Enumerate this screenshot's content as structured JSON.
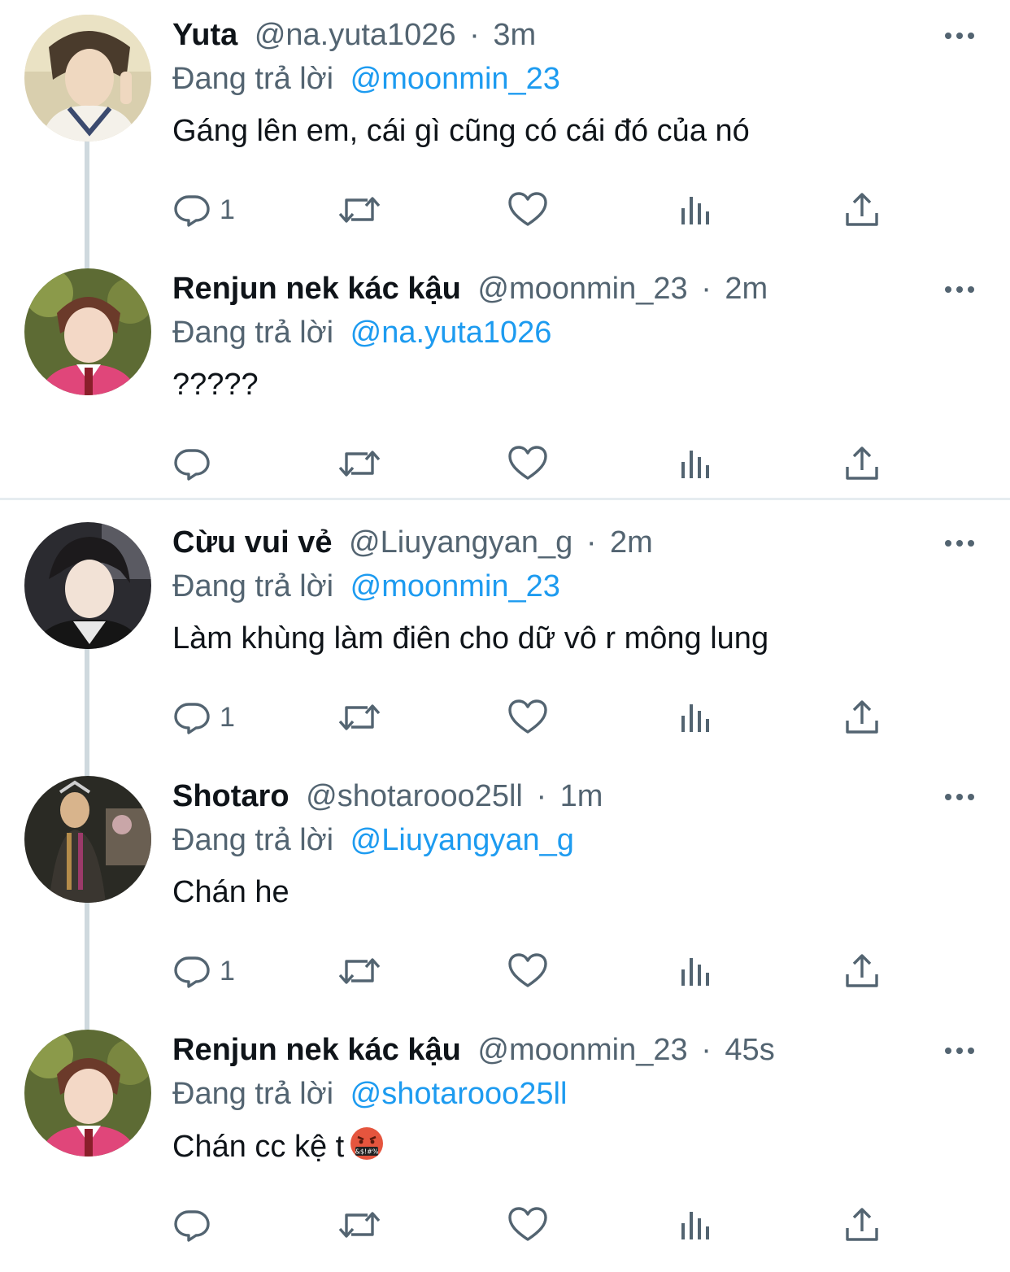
{
  "tweets": [
    {
      "name": "Yuta",
      "handle": "@na.yuta1026",
      "dot": "·",
      "time": "3m",
      "reply_prefix": "Đang trả lời",
      "reply_to": "@moonmin_23",
      "text": "Gáng lên em, cái gì cũng có cái đó của nó",
      "reply_count": "1",
      "avatar": "avatar-yuta"
    },
    {
      "name": "Renjun nek kác kậu",
      "handle": "@moonmin_23",
      "dot": "·",
      "time": "2m",
      "reply_prefix": "Đang trả lời",
      "reply_to": "@na.yuta1026",
      "text": "?????",
      "reply_count": "",
      "avatar": "avatar-renjun"
    },
    {
      "name": "Cừu vui vẻ",
      "handle": "@Liuyangyan_g",
      "dot": "·",
      "time": "2m",
      "reply_prefix": "Đang trả lời",
      "reply_to": "@moonmin_23",
      "text": "Làm khùng làm điên cho dữ vô r mông lung",
      "reply_count": "1",
      "avatar": "avatar-cuu"
    },
    {
      "name": "Shotaro",
      "handle": "@shotarooo25ll",
      "dot": "·",
      "time": "1m",
      "reply_prefix": "Đang trả lời",
      "reply_to": "@Liuyangyan_g",
      "text": "Chán he",
      "reply_count": "1",
      "avatar": "avatar-shotaro"
    },
    {
      "name": "Renjun nek kác kậu",
      "handle": "@moonmin_23",
      "dot": "·",
      "time": "45s",
      "reply_prefix": "Đang trả lời",
      "reply_to": "@shotarooo25ll",
      "text": "Chán cc kệ t",
      "reply_count": "",
      "avatar": "avatar-renjun",
      "emoji": "swearing-face-emoji"
    }
  ],
  "icons": {
    "reply": "reply-icon",
    "retweet": "retweet-icon",
    "like": "like-icon",
    "analytics": "analytics-icon",
    "share": "share-icon",
    "more": "more-icon"
  },
  "colors": {
    "mention": "#1d9bf0",
    "secondary": "#536471",
    "primary": "#0f1419",
    "thread_line": "#cfd9de"
  }
}
